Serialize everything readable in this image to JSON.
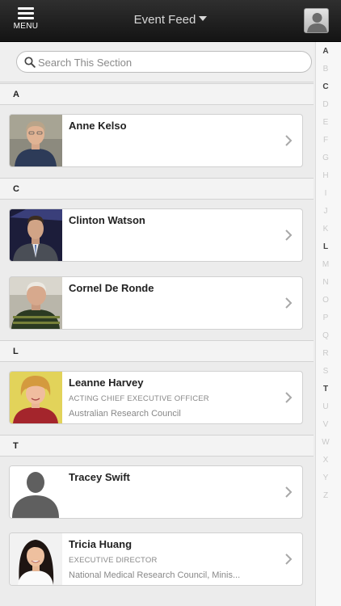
{
  "header": {
    "menu_label": "MENU",
    "title": "Event Feed",
    "icons": {
      "menu": "hamburger-icon",
      "dropdown": "caret-down-icon",
      "profile": "user-avatar-icon"
    }
  },
  "search": {
    "placeholder": "Search This Section",
    "value": "",
    "icon": "search-icon"
  },
  "sections": [
    {
      "letter": "A"
    },
    {
      "letter": "C"
    },
    {
      "letter": "L"
    },
    {
      "letter": "T"
    }
  ],
  "people": [
    {
      "name": "Anne Kelso",
      "title": "",
      "org": ""
    },
    {
      "name": "Clinton Watson",
      "title": "",
      "org": ""
    },
    {
      "name": "Cornel De Ronde",
      "title": "",
      "org": ""
    },
    {
      "name": "Leanne Harvey",
      "title": "ACTING CHIEF EXECUTIVE OFFICER",
      "org": "Australian Research Council"
    },
    {
      "name": "Tracey Swift",
      "title": "",
      "org": ""
    },
    {
      "name": "Tricia Huang",
      "title": "EXECUTIVE DIRECTOR",
      "org": "National Medical Research Council, Minis..."
    }
  ],
  "alpha_index": {
    "letters": [
      "A",
      "B",
      "C",
      "D",
      "E",
      "F",
      "G",
      "H",
      "I",
      "J",
      "K",
      "L",
      "M",
      "N",
      "O",
      "P",
      "Q",
      "R",
      "S",
      "T",
      "U",
      "V",
      "W",
      "X",
      "Y",
      "Z"
    ],
    "active": [
      "A",
      "C",
      "L",
      "T"
    ]
  },
  "colors": {
    "topbar": "#1f1f1f",
    "background": "#ececec",
    "card": "#ffffff",
    "chevron": "#a8a8a8"
  }
}
